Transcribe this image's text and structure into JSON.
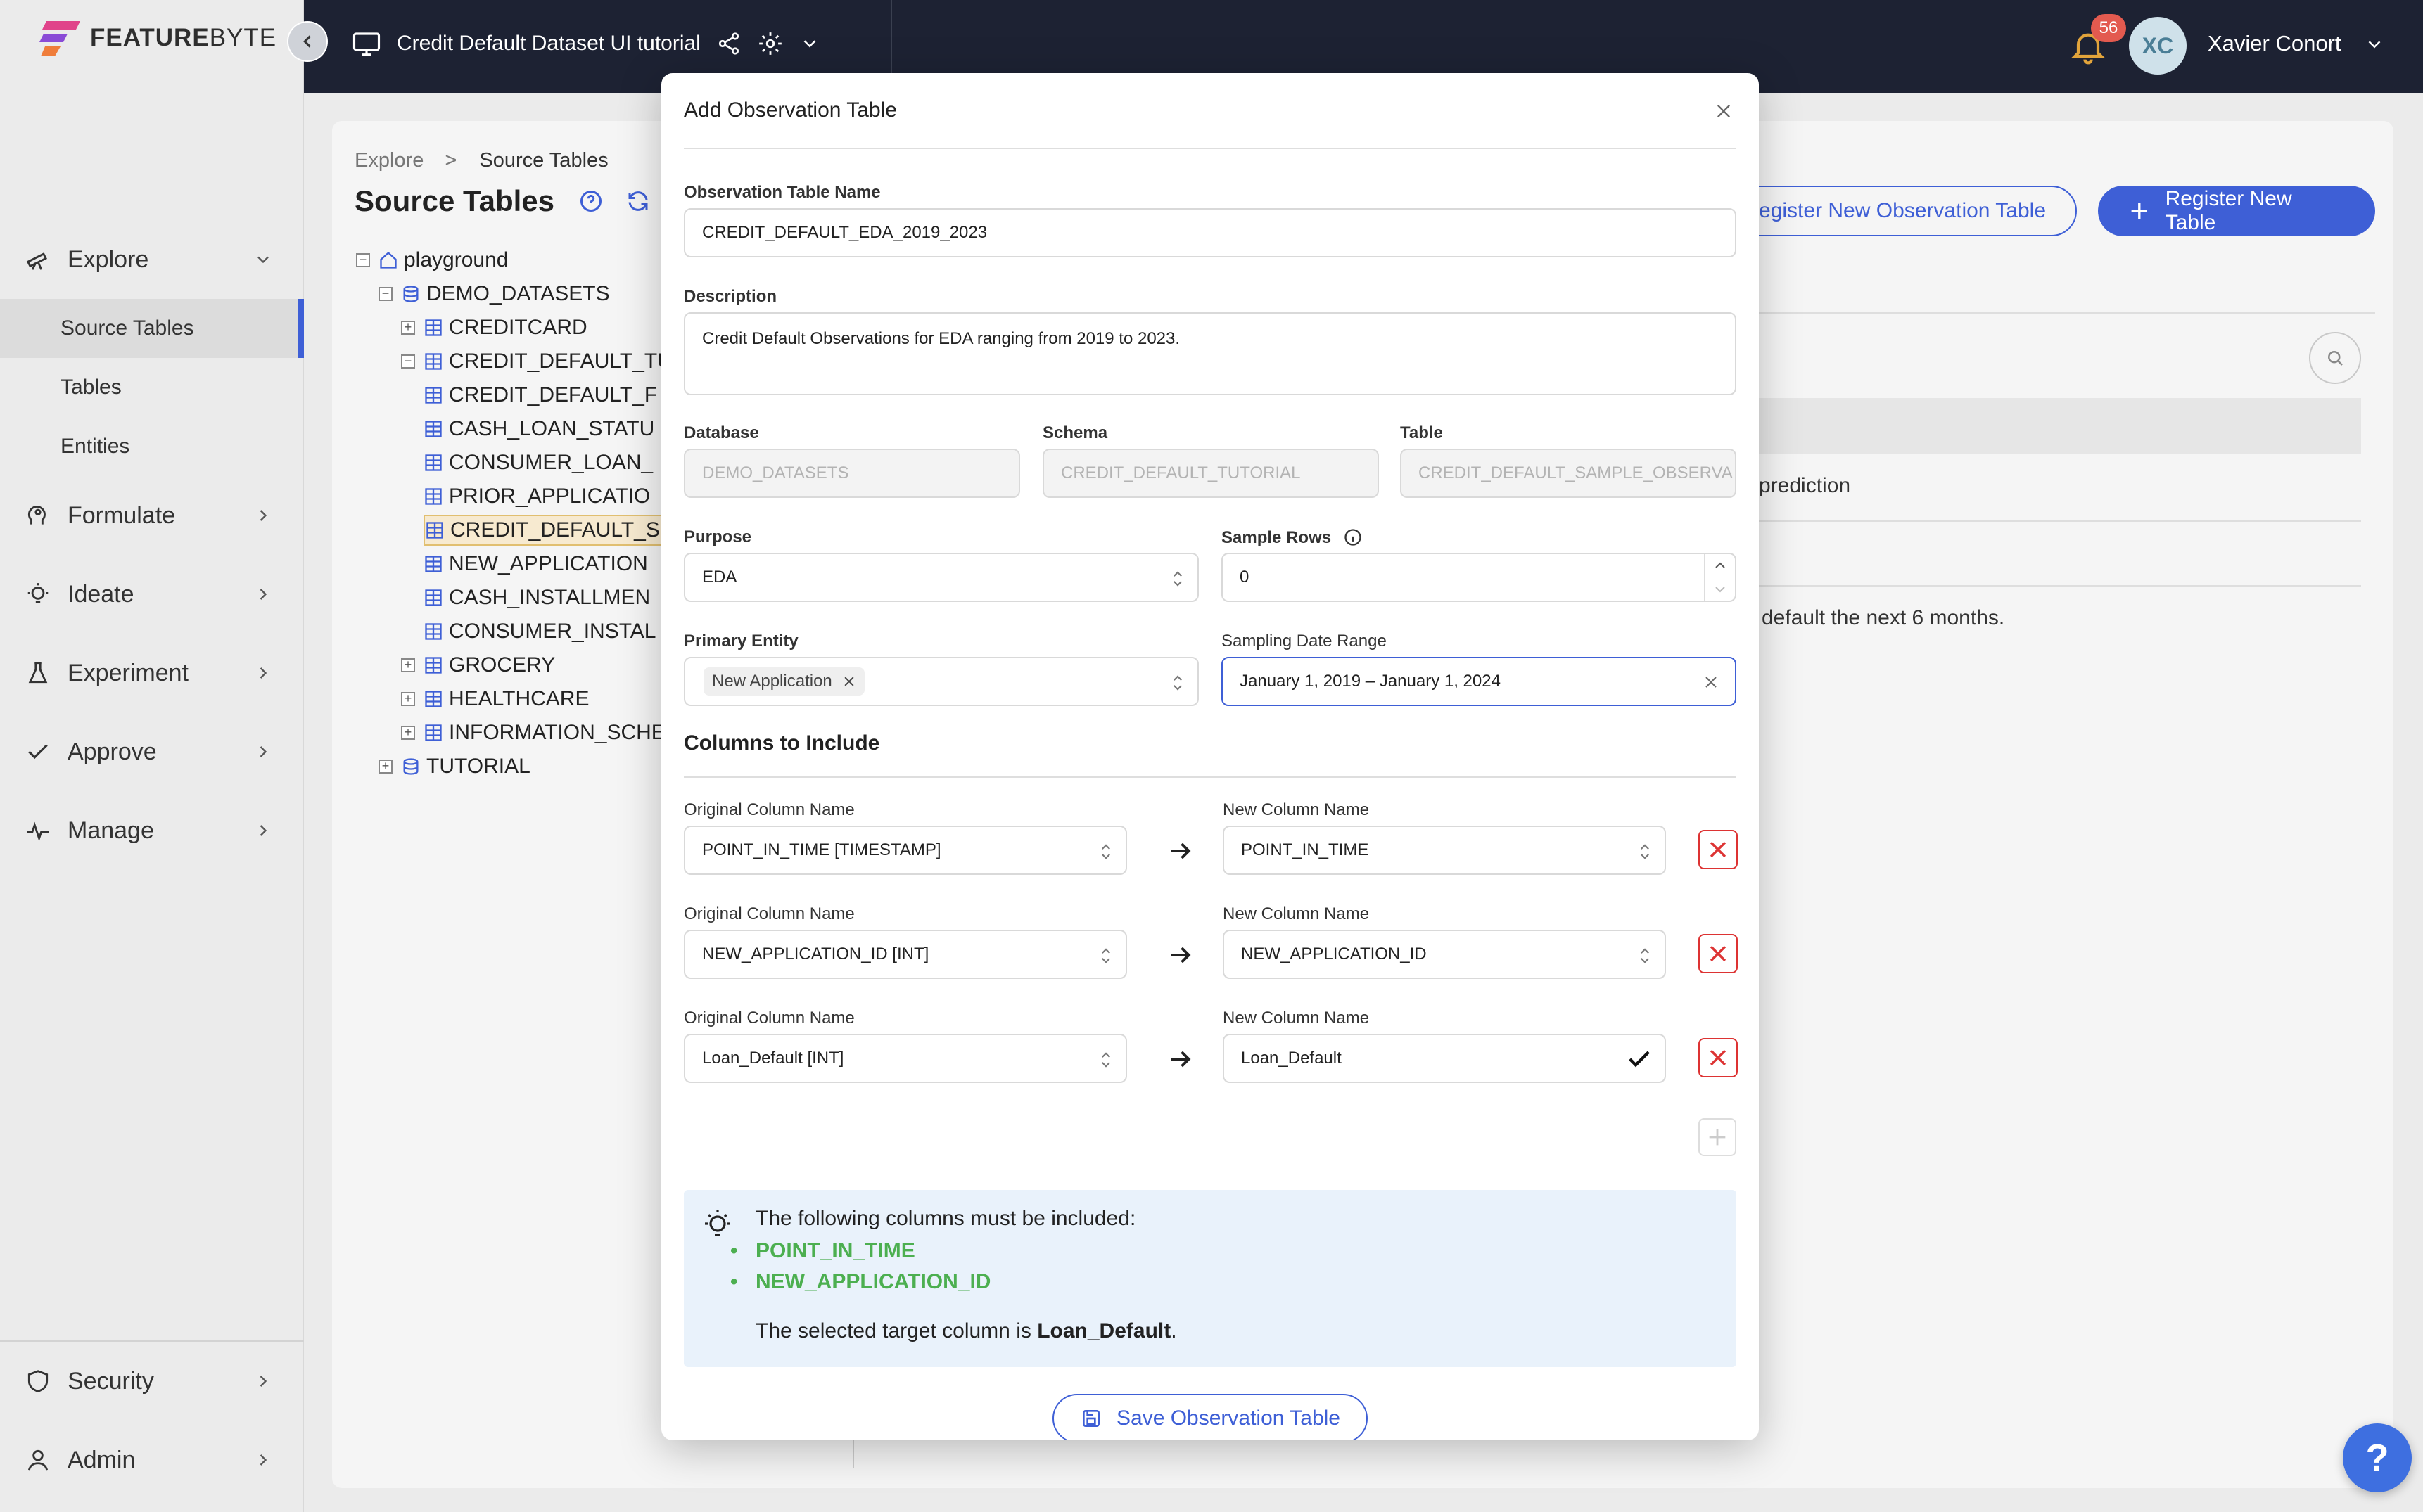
{
  "app": {
    "logo_strong": "FEATURE",
    "logo_light": "BYTE",
    "catalog_title": "Credit Default Dataset UI tutorial"
  },
  "user": {
    "initials": "XC",
    "name": "Xavier Conort",
    "notifications": "56"
  },
  "sidebar": {
    "explore": "Explore",
    "explore_sub": [
      "Source Tables",
      "Tables",
      "Entities"
    ],
    "formulate": "Formulate",
    "ideate": "Ideate",
    "experiment": "Experiment",
    "approve": "Approve",
    "manage": "Manage",
    "security": "Security",
    "admin": "Admin"
  },
  "page": {
    "breadcrumb_root": "Explore",
    "breadcrumb_sep": ">",
    "breadcrumb_current": "Source Tables",
    "title": "Source Tables",
    "btn_register_obs": "Register New Observation Table",
    "btn_register_table": "Register New Table",
    "bg_text_1": "prediction",
    "bg_text_2": "default the next 6 months."
  },
  "tree": [
    {
      "label": "playground",
      "toggle": "−"
    },
    {
      "label": "DEMO_DATASETS",
      "toggle": "−"
    },
    {
      "label": "CREDITCARD",
      "toggle": "+"
    },
    {
      "label": "CREDIT_DEFAULT_TUT",
      "toggle": "−"
    },
    {
      "label": "CREDIT_DEFAULT_F"
    },
    {
      "label": "CASH_LOAN_STATU"
    },
    {
      "label": "CONSUMER_LOAN_"
    },
    {
      "label": "PRIOR_APPLICATIO"
    },
    {
      "label": "CREDIT_DEFAULT_S"
    },
    {
      "label": "NEW_APPLICATION"
    },
    {
      "label": "CASH_INSTALLMEN"
    },
    {
      "label": "CONSUMER_INSTAL"
    },
    {
      "label": "GROCERY",
      "toggle": "+"
    },
    {
      "label": "HEALTHCARE",
      "toggle": "+"
    },
    {
      "label": "INFORMATION_SCHEM",
      "toggle": "+"
    },
    {
      "label": "TUTORIAL",
      "toggle": "+"
    }
  ],
  "modal": {
    "title": "Add Observation Table",
    "name_label": "Observation Table Name",
    "name_value": "CREDIT_DEFAULT_EDA_2019_2023",
    "desc_label": "Description",
    "desc_value": "Credit Default Observations for EDA ranging from 2019 to 2023.",
    "database_label": "Database",
    "database_value": "DEMO_DATASETS",
    "schema_label": "Schema",
    "schema_value": "CREDIT_DEFAULT_TUTORIAL",
    "table_label": "Table",
    "table_value": "CREDIT_DEFAULT_SAMPLE_OBSERVA",
    "purpose_label": "Purpose",
    "purpose_value": "EDA",
    "sample_rows_label": "Sample Rows",
    "sample_rows_value": "0",
    "entity_label": "Primary Entity",
    "entity_tag": "New Application",
    "date_range_label": "Sampling Date Range",
    "date_range_value": "January 1, 2019 – January 1, 2024",
    "columns_title": "Columns to Include",
    "orig_col_label": "Original Column Name",
    "new_col_label": "New Column Name",
    "columns": [
      {
        "original": "POINT_IN_TIME [TIMESTAMP]",
        "new": "POINT_IN_TIME"
      },
      {
        "original": "NEW_APPLICATION_ID [INT]",
        "new": "NEW_APPLICATION_ID"
      },
      {
        "original": "Loan_Default [INT]",
        "new": "Loan_Default"
      }
    ],
    "info_heading": "The following columns must be included:",
    "required_cols": [
      "POINT_IN_TIME",
      "NEW_APPLICATION_ID"
    ],
    "target_prefix": "The selected target column is ",
    "target_col": "Loan_Default",
    "target_suffix": ".",
    "save_label": "Save Observation Table"
  },
  "colors": {
    "accent": "#3e5fd6",
    "topbar": "#1d2233",
    "danger": "#dd3333",
    "success": "#4caf50"
  }
}
